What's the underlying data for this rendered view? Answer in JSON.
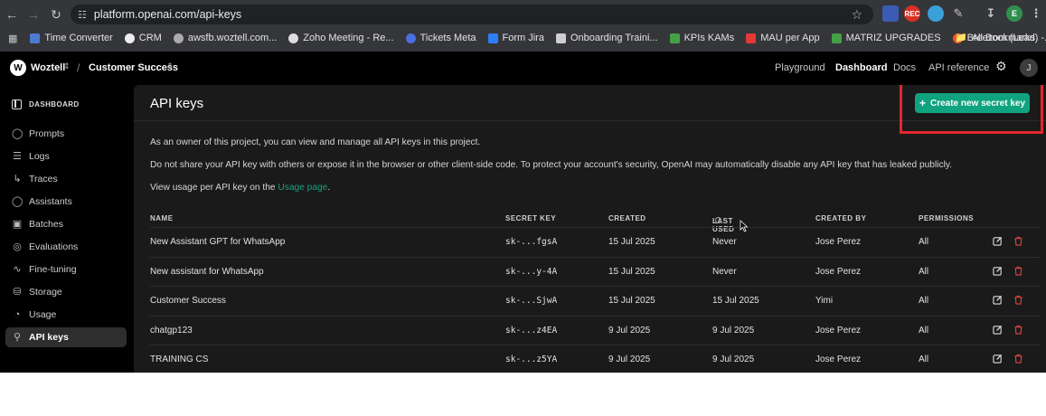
{
  "browser": {
    "url": "platform.openai.com/api-keys",
    "ext_rec": "REC",
    "profile_initial": "E",
    "bookmarks": [
      "Time Converter",
      "CRM",
      "awsfb.woztell.com...",
      "Zoho Meeting - Re...",
      "Tickets Meta",
      "Form Jira",
      "Onboarding Traini...",
      "KPIs KAMs",
      "MAU per App",
      "MATRIZ UPGRADES",
      "Breezom (Lead) -..."
    ],
    "all_bookmarks": "All Bookmarks"
  },
  "header": {
    "org_initial": "W",
    "org_name": "Woztell",
    "separator": "/",
    "project_name": "Customer Success",
    "nav": [
      "Playground",
      "Dashboard",
      "Docs",
      "API reference"
    ],
    "active_nav": "Dashboard",
    "user_initial": "J"
  },
  "sidebar": {
    "section": "DASHBOARD",
    "items": [
      {
        "label": "Prompts",
        "icon": "chat-bubble-icon"
      },
      {
        "label": "Logs",
        "icon": "list-icon"
      },
      {
        "label": "Traces",
        "icon": "traces-icon"
      },
      {
        "label": "Assistants",
        "icon": "assistant-icon"
      },
      {
        "label": "Batches",
        "icon": "batches-icon"
      },
      {
        "label": "Evaluations",
        "icon": "evaluations-icon"
      },
      {
        "label": "Fine-tuning",
        "icon": "fine-tuning-icon"
      },
      {
        "label": "Storage",
        "icon": "storage-icon"
      },
      {
        "label": "Usage",
        "icon": "usage-icon"
      },
      {
        "label": "API keys",
        "icon": "key-icon"
      }
    ],
    "active": "API keys"
  },
  "main": {
    "title": "API keys",
    "create_button": "Create new secret key",
    "para1": "As an owner of this project, you can view and manage all API keys in this project.",
    "para2": "Do not share your API key with others or expose it in the browser or other client-side code. To protect your account's security, OpenAI may automatically disable any API key that has leaked publicly.",
    "para3_prefix": "View usage per API key on the ",
    "para3_link": "Usage page",
    "para3_suffix": ".",
    "columns": [
      "NAME",
      "SECRET KEY",
      "CREATED",
      "LAST USED",
      "CREATED BY",
      "PERMISSIONS"
    ],
    "rows": [
      {
        "name": "New Assistant GPT for WhatsApp",
        "key": "sk-...fgsA",
        "created": "15 Jul 2025",
        "last_used": "Never",
        "created_by": "Jose Perez",
        "permissions": "All"
      },
      {
        "name": "New assistant for WhatsApp",
        "key": "sk-...y-4A",
        "created": "15 Jul 2025",
        "last_used": "Never",
        "created_by": "Jose Perez",
        "permissions": "All"
      },
      {
        "name": "Customer Success",
        "key": "sk-...SjwA",
        "created": "15 Jul 2025",
        "last_used": "15 Jul 2025",
        "created_by": "Yimi",
        "permissions": "All"
      },
      {
        "name": "chatgp123",
        "key": "sk-...z4EA",
        "created": "9 Jul 2025",
        "last_used": "9 Jul 2025",
        "created_by": "Jose Perez",
        "permissions": "All"
      },
      {
        "name": "TRAINING CS",
        "key": "sk-...z5YA",
        "created": "9 Jul 2025",
        "last_used": "9 Jul 2025",
        "created_by": "Jose Perez",
        "permissions": "All"
      }
    ]
  },
  "colors": {
    "accent": "#10a37f",
    "highlight": "#e3262d",
    "danger": "#e0443e"
  }
}
